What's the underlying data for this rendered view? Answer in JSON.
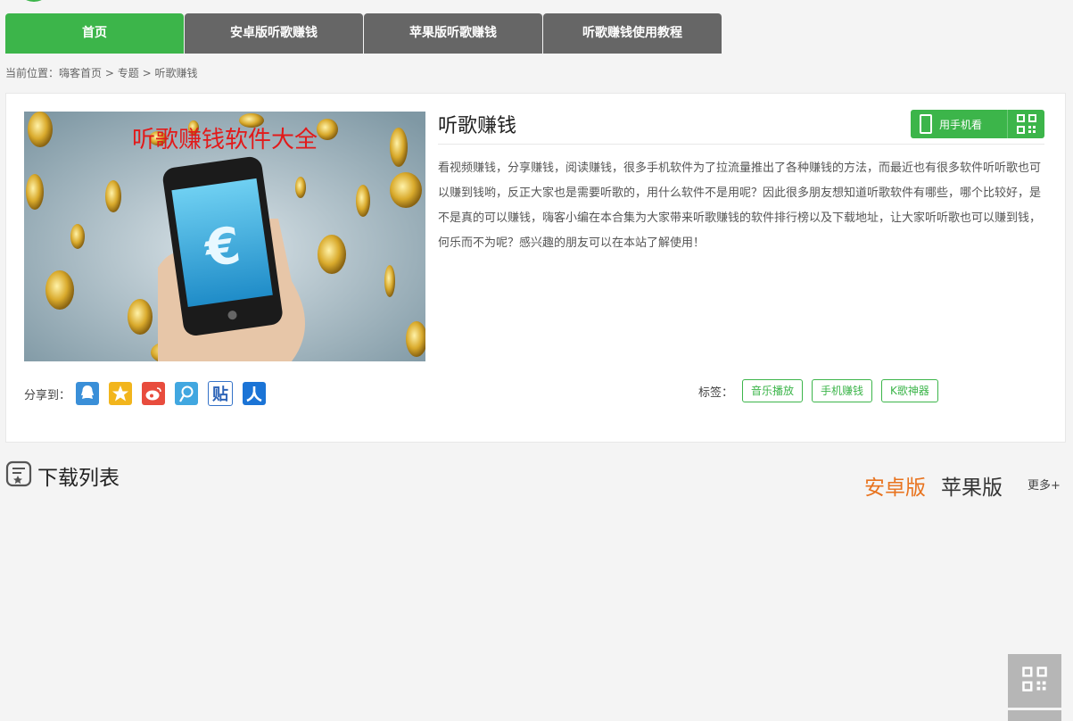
{
  "nav": {
    "tabs": [
      {
        "label": "首页"
      },
      {
        "label": "安卓版听歌赚钱"
      },
      {
        "label": "苹果版听歌赚钱"
      },
      {
        "label": "听歌赚钱使用教程"
      }
    ]
  },
  "breadcrumb": {
    "prefix": "当前位置：",
    "items": [
      "嗨客首页",
      "专题",
      "听歌赚钱"
    ],
    "separator": ">"
  },
  "topic": {
    "banner_text": "听歌赚钱软件大全",
    "title": "听歌赚钱",
    "mobile_button": "用手机看",
    "description": "看视频赚钱，分享赚钱，阅读赚钱，很多手机软件为了拉流量推出了各种赚钱的方法，而最近也有很多软件听听歌也可以赚到钱哟，反正大家也是需要听歌的，用什么软件不是用呢？因此很多朋友想知道听歌软件有哪些，哪个比较好，是不是真的可以赚钱，嗨客小编在本合集为大家带来听歌赚钱的软件排行榜以及下载地址，让大家听听歌也可以赚到钱，何乐而不为呢？感兴趣的朋友可以在本站了解使用！",
    "share_label": "分享到：",
    "share_icons": [
      "qq-icon",
      "qzone-icon",
      "weibo-icon",
      "tencent-weibo-icon",
      "tieba-icon",
      "renren-icon"
    ],
    "tags_label": "标签：",
    "tags": [
      "音乐播放",
      "手机赚钱",
      "K歌神器"
    ]
  },
  "downloads": {
    "title": "下载列表",
    "tabs": [
      "安卓版",
      "苹果版"
    ],
    "more": "更多+"
  },
  "colors": {
    "accent": "#3cb54a",
    "nav_dark": "#666666",
    "active_os_tab": "#e8731e"
  }
}
